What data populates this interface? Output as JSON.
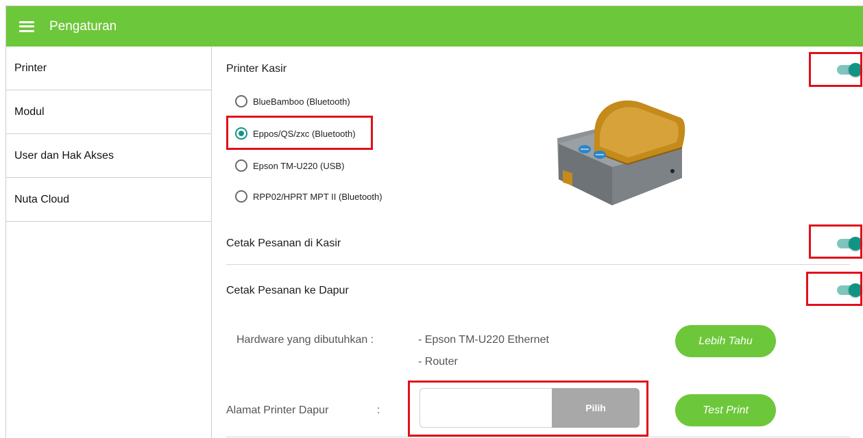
{
  "appbar": {
    "title": "Pengaturan",
    "color": "#6dc73a"
  },
  "sidebar": {
    "items": [
      {
        "label": "Printer"
      },
      {
        "label": "Modul"
      },
      {
        "label": "User dan Hak Akses"
      },
      {
        "label": "Nuta Cloud"
      }
    ]
  },
  "printer_kasir": {
    "title": "Printer Kasir",
    "enabled": true,
    "options": [
      {
        "label": "BlueBamboo (Bluetooth)",
        "selected": false
      },
      {
        "label": "Eppos/QS/zxc (Bluetooth)",
        "selected": true
      },
      {
        "label": "Epson TM-U220 (USB)",
        "selected": false
      },
      {
        "label": "RPP02/HPRT MPT II (Bluetooth)",
        "selected": false
      }
    ]
  },
  "cetak_kasir": {
    "title": "Cetak Pesanan di Kasir",
    "enabled": true
  },
  "cetak_dapur": {
    "title": "Cetak Pesanan ke Dapur",
    "enabled": true,
    "hardware_label": "Hardware yang dibutuhkan :",
    "hardware_items": [
      "- Epson TM-U220 Ethernet",
      "- Router"
    ],
    "learn_more_label": "Lebih Tahu",
    "address_label": "Alamat Printer Dapur",
    "address_colon": ":",
    "address_value": "",
    "pick_label": "Pilih",
    "test_print_label": "Test Print"
  },
  "colors": {
    "toggle_on": "#129485",
    "accent_green": "#6dc73a",
    "highlight_red": "#e0101a"
  }
}
